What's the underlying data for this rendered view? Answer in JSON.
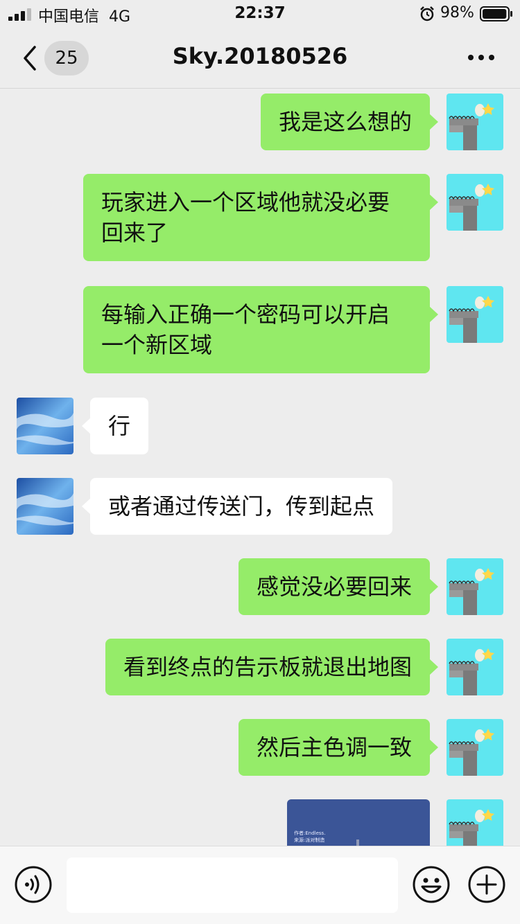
{
  "status_bar": {
    "carrier": "中国电信",
    "network": "4G",
    "time": "22:37",
    "battery_percent": "98%",
    "battery_level": 0.98
  },
  "nav": {
    "unread_count": "25",
    "title": "Sky.20180526"
  },
  "messages": [
    {
      "side": "right",
      "type": "text",
      "text": "我是这么想的"
    },
    {
      "side": "right",
      "type": "text",
      "lines": [
        "玩家进入一个区域他就没必要",
        "回来了"
      ]
    },
    {
      "side": "right",
      "type": "text",
      "lines": [
        "每输入正确一个密码可以开启",
        "一个新区域"
      ]
    },
    {
      "side": "left",
      "type": "text",
      "text": "行"
    },
    {
      "side": "left",
      "type": "text",
      "text": "或者通过传送门，传到起点"
    },
    {
      "side": "right",
      "type": "text",
      "text": "感觉没必要回来"
    },
    {
      "side": "right",
      "type": "text",
      "text": "看到终点的告示板就退出地图"
    },
    {
      "side": "right",
      "type": "text",
      "text": "然后主色调一致"
    },
    {
      "side": "right",
      "type": "image",
      "caption_lines": [
        "作者:Endless.",
        "来源:派对制造"
      ]
    }
  ],
  "colors": {
    "background": "#ededed",
    "bubble_self": "#95ec69",
    "bubble_other": "#ffffff",
    "avatar_self_bg": "#5fe6f0"
  },
  "icons": {
    "back": "chevron-left-icon",
    "more": "ellipsis-icon",
    "voice": "voice-icon",
    "emoji": "emoji-icon",
    "plus": "plus-icon"
  },
  "input": {
    "value": ""
  }
}
